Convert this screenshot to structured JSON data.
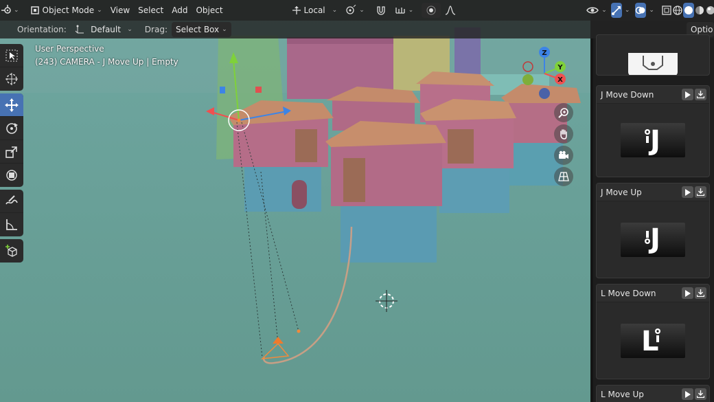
{
  "header": {
    "mode": "Object Mode",
    "menus": [
      "View",
      "Select",
      "Add",
      "Object"
    ],
    "transform_orientation": "Local",
    "options_label": "Optio"
  },
  "tool_header": {
    "orientation_label": "Orientation:",
    "orientation_value": "Default",
    "drag_label": "Drag:",
    "drag_value": "Select Box"
  },
  "viewport": {
    "perspective_text": "User Perspective",
    "object_info": "(243) CAMERA - J Move Up | Empty",
    "colors": {
      "background": "#6aa39d",
      "selection": "#f08a3c",
      "active_button": "#4772b3"
    }
  },
  "toolbar": {
    "tools": [
      "select-box",
      "cursor",
      "move",
      "rotate",
      "scale",
      "transform",
      "annotate",
      "measure",
      "add-cube"
    ],
    "active": "move"
  },
  "gizmo": {
    "axes": [
      "Z",
      "Y",
      "X"
    ]
  },
  "sidebar": {
    "cards": [
      {
        "title": "",
        "glyph": ""
      },
      {
        "title": "J Move Down",
        "glyph": "J"
      },
      {
        "title": "J Move Up",
        "glyph": "J"
      },
      {
        "title": "L Move Down",
        "glyph": "L"
      },
      {
        "title": "L Move Up",
        "glyph": ""
      }
    ]
  }
}
